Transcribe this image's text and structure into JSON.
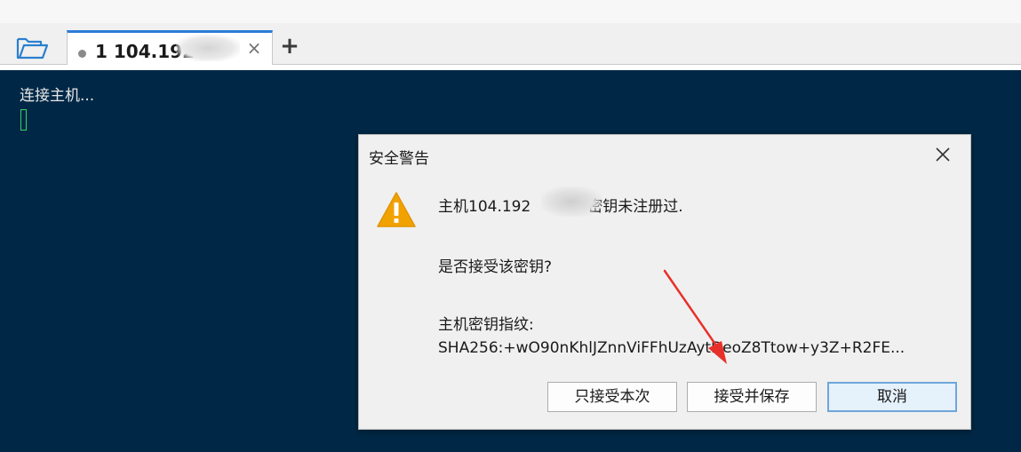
{
  "tab_bar": {
    "active_tab": {
      "number": "1",
      "host_partial": "104.192"
    },
    "add_tab_label": "+",
    "close_tab_label": "×"
  },
  "terminal": {
    "status_text": "连接主机..."
  },
  "dialog": {
    "title": "安全警告",
    "host_message_prefix": "主机104.192",
    "host_message_suffix": "密钥未注册过.",
    "accept_question": "是否接受该密钥?",
    "fingerprint_label": "主机密钥指纹:",
    "fingerprint_value": "SHA256:+wO90nKhlJZnnViFFhUzAytDeoZ8Ttow+y3Z+R2FE...",
    "buttons": {
      "accept_once": "只接受本次",
      "accept_and_save": "接受并保存",
      "cancel": "取消"
    }
  },
  "colors": {
    "terminal_bg": "#002846",
    "tab_accent": "#2b7bd6",
    "cursor": "#37d06a",
    "warning": "#f2a200",
    "annotation_arrow": "#e8302a"
  }
}
